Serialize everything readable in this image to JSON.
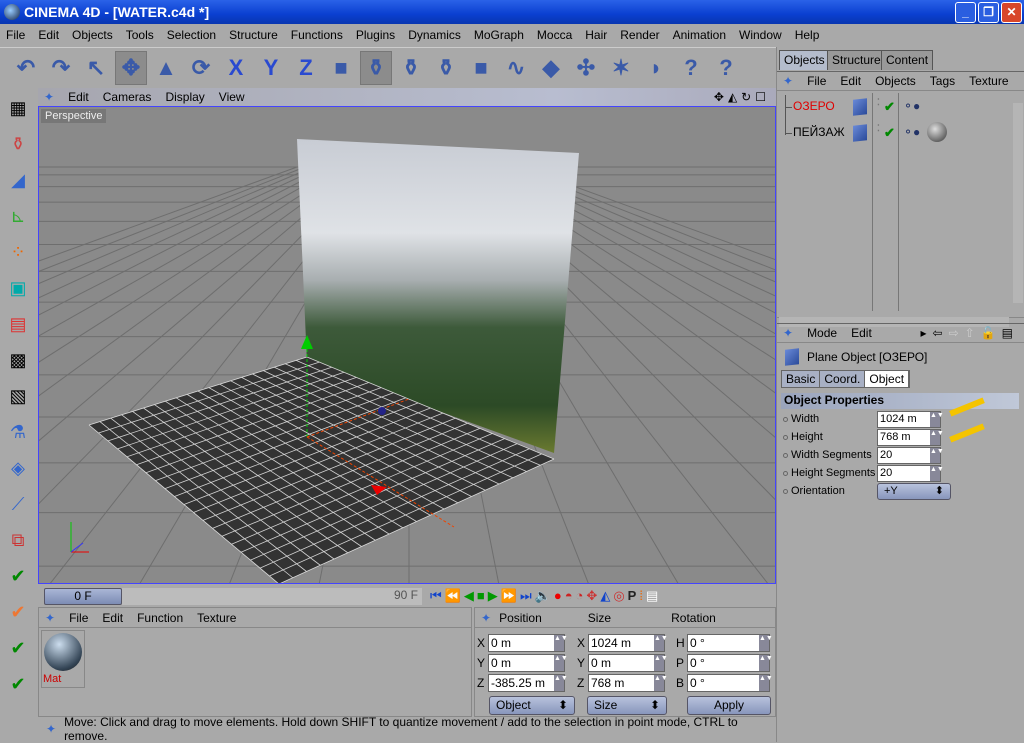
{
  "window": {
    "title": "CINEMA 4D - [WATER.c4d *]",
    "minimize": "_",
    "restore": "❐",
    "close": "✕"
  },
  "menu": [
    "File",
    "Edit",
    "Objects",
    "Tools",
    "Selection",
    "Structure",
    "Functions",
    "Plugins",
    "Dynamics",
    "MoGraph",
    "Mocca",
    "Hair",
    "Render",
    "Animation",
    "Window",
    "Help"
  ],
  "toolbar": [
    {
      "icon": "undo-icon",
      "g": "↶"
    },
    {
      "icon": "redo-icon",
      "g": "↷"
    },
    {
      "icon": "select-pointer-icon",
      "g": "↖"
    },
    {
      "icon": "move-icon",
      "g": "✥",
      "sel": true
    },
    {
      "icon": "scale-icon",
      "g": "▲"
    },
    {
      "icon": "rotate-icon",
      "g": "⟳"
    },
    {
      "icon": "x-axis-icon",
      "g": "X"
    },
    {
      "icon": "y-axis-icon",
      "g": "Y"
    },
    {
      "icon": "z-axis-icon",
      "g": "Z"
    },
    {
      "icon": "world-coords-icon",
      "g": "■"
    },
    {
      "icon": "render-view-icon",
      "g": "⚱",
      "sel": true
    },
    {
      "icon": "render-region-icon",
      "g": "⚱"
    },
    {
      "icon": "render-settings-icon",
      "g": "⚱"
    },
    {
      "icon": "cube-icon",
      "g": "■"
    },
    {
      "icon": "spline-icon",
      "g": "∿"
    },
    {
      "icon": "nurbs-icon",
      "g": "◆"
    },
    {
      "icon": "array-icon",
      "g": "✣"
    },
    {
      "icon": "light-icon",
      "g": "✶"
    },
    {
      "icon": "deformer-icon",
      "g": "◗"
    },
    {
      "icon": "help-pointer-icon",
      "g": "?"
    },
    {
      "icon": "help-table-icon",
      "g": "?"
    }
  ],
  "viewport": {
    "menu": [
      "Edit",
      "Cameras",
      "Display",
      "View"
    ],
    "label": "Perspective"
  },
  "timeline": {
    "current_frame": "0 F",
    "end_frame": "90 F"
  },
  "material_manager": {
    "menu": [
      "File",
      "Edit",
      "Function",
      "Texture"
    ],
    "materials": [
      {
        "name": "Mat"
      }
    ]
  },
  "coordinates": {
    "headers": [
      "Position",
      "Size",
      "Rotation"
    ],
    "rows": [
      {
        "pl": "X",
        "pv": "0 m",
        "sl": "X",
        "sv": "1024 m",
        "rl": "H",
        "rv": "0 °"
      },
      {
        "pl": "Y",
        "pv": "0 m",
        "sl": "Y",
        "sv": "0 m",
        "rl": "P",
        "rv": "0 °"
      },
      {
        "pl": "Z",
        "pv": "-385.25 m",
        "sl": "Z",
        "sv": "768 m",
        "rl": "B",
        "rv": "0 °"
      }
    ],
    "mode_select": "Object",
    "size_select": "Size",
    "apply": "Apply"
  },
  "status": "Move: Click and drag to move elements. Hold down SHIFT to quantize movement / add to the selection in point mode, CTRL to remove.",
  "objects_panel": {
    "tabs": [
      "Objects",
      "Structure",
      "Content"
    ],
    "active_tab": "Objects",
    "menu": [
      "File",
      "Edit",
      "Objects",
      "Tags",
      "Texture"
    ],
    "items": [
      {
        "name": "ОЗЕРО",
        "selected": true,
        "color": "#e00000"
      },
      {
        "name": "ПЕЙЗАЖ",
        "selected": false,
        "color": "#000000"
      }
    ]
  },
  "attributes": {
    "menu": [
      "Mode",
      "Edit"
    ],
    "title": "Plane Object [ОЗЕРО]",
    "tabs": [
      "Basic",
      "Coord.",
      "Object"
    ],
    "active_tab": "Object",
    "section": "Object Properties",
    "props": [
      {
        "label": "Width",
        "value": "1024 m"
      },
      {
        "label": "Height",
        "value": "768 m"
      },
      {
        "label": "Width Segments",
        "value": "20"
      },
      {
        "label": "Height Segments",
        "value": "20"
      },
      {
        "label": "Orientation",
        "value": "+Y"
      }
    ]
  },
  "colors": {
    "titlebar": "#0a3fd0",
    "panel": "#a9a9a9",
    "annotation_arrow": "#f4c400",
    "selected_object": "#e00000"
  }
}
